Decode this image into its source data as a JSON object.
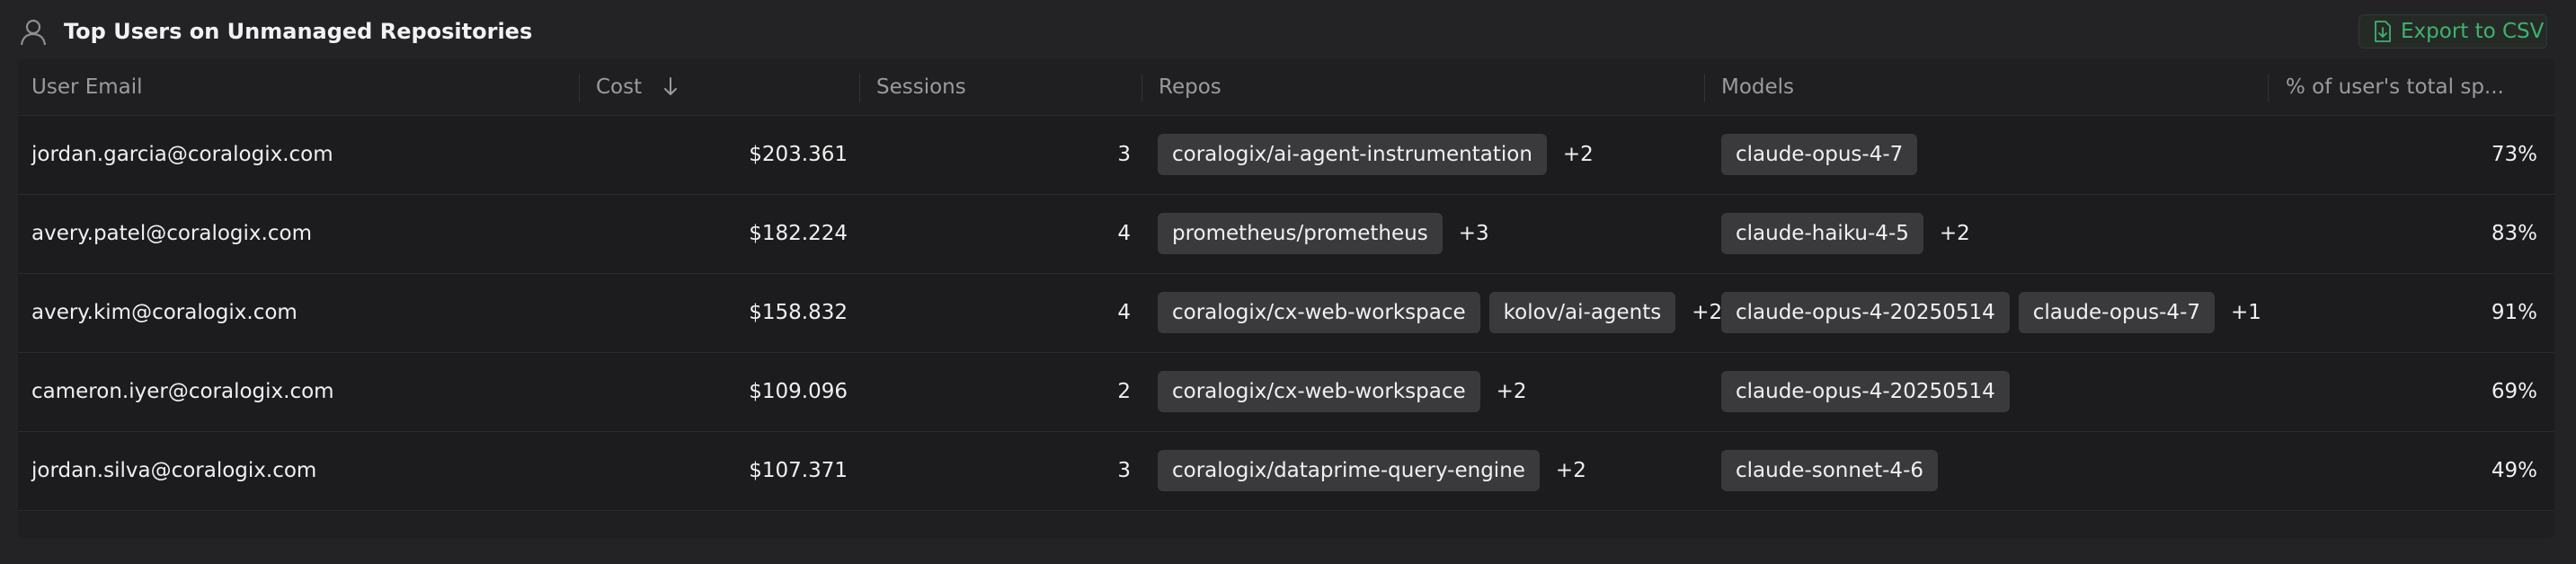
{
  "header": {
    "title": "Top Users on Unmanaged Repositories",
    "export_label": "Export to CSV",
    "icon": "user-icon",
    "export_icon": "download-file-icon",
    "accent_color": "#3fb26f"
  },
  "table": {
    "columns": [
      {
        "label": "User Email"
      },
      {
        "label": "Cost",
        "sort": "descending"
      },
      {
        "label": "Sessions"
      },
      {
        "label": "Repos"
      },
      {
        "label": "Models"
      },
      {
        "label": "% of user's total sp..."
      }
    ],
    "rows": [
      {
        "email": "jordan.garcia@coralogix.com",
        "cost": "$203.361",
        "sessions": "3",
        "repos": [
          "coralogix/ai-agent-instrumentation"
        ],
        "repos_more": "+2",
        "models": [
          "claude-opus-4-7"
        ],
        "models_more": "",
        "pct": "73%"
      },
      {
        "email": "avery.patel@coralogix.com",
        "cost": "$182.224",
        "sessions": "4",
        "repos": [
          "prometheus/prometheus"
        ],
        "repos_more": "+3",
        "models": [
          "claude-haiku-4-5"
        ],
        "models_more": "+2",
        "pct": "83%"
      },
      {
        "email": "avery.kim@coralogix.com",
        "cost": "$158.832",
        "sessions": "4",
        "repos": [
          "coralogix/cx-web-workspace",
          "kolov/ai-agents"
        ],
        "repos_more": "+2",
        "models": [
          "claude-opus-4-20250514",
          "claude-opus-4-7"
        ],
        "models_more": "+1",
        "pct": "91%"
      },
      {
        "email": "cameron.iyer@coralogix.com",
        "cost": "$109.096",
        "sessions": "2",
        "repos": [
          "coralogix/cx-web-workspace"
        ],
        "repos_more": "+2",
        "models": [
          "claude-opus-4-20250514"
        ],
        "models_more": "",
        "pct": "69%"
      },
      {
        "email": "jordan.silva@coralogix.com",
        "cost": "$107.371",
        "sessions": "3",
        "repos": [
          "coralogix/dataprime-query-engine"
        ],
        "repos_more": "+2",
        "models": [
          "claude-sonnet-4-6"
        ],
        "models_more": "",
        "pct": "49%"
      }
    ]
  }
}
